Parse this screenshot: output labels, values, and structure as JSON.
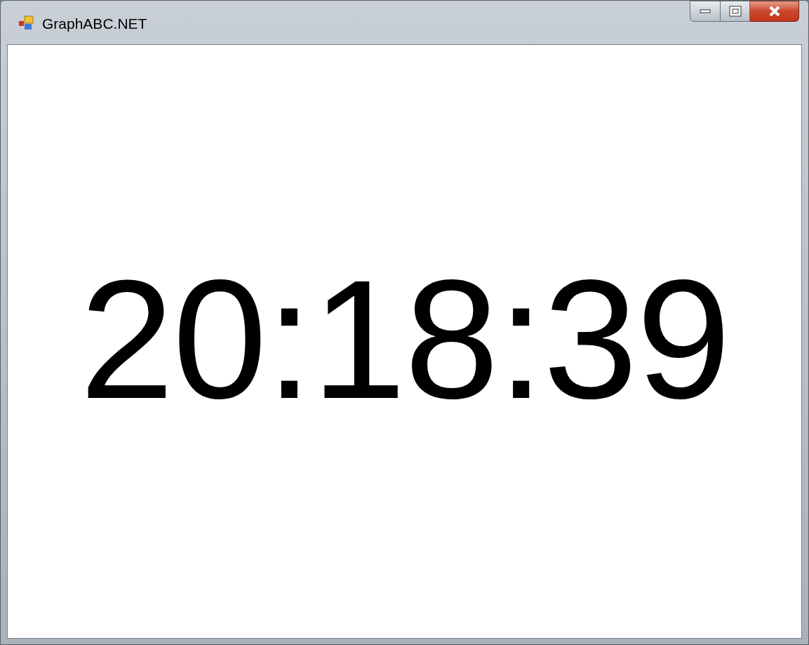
{
  "window": {
    "title": "GraphABC.NET"
  },
  "clock": {
    "time": "20:18:39"
  }
}
